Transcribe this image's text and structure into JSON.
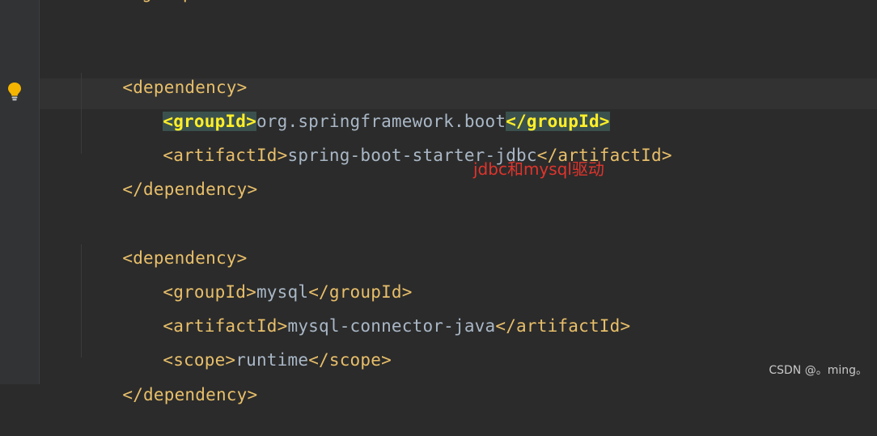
{
  "editor": {
    "top_fragment": "</groupId>",
    "lines": {
      "dep1_open": "<dependency>",
      "dep1_group_open": "<groupId>",
      "dep1_group_value": "org.springframework.boot",
      "dep1_group_close": "</groupId>",
      "dep1_artifact_open": "<artifactId>",
      "dep1_artifact_value": "spring-boot-starter-jdbc",
      "dep1_artifact_close": "</artifactId>",
      "dep1_close": "</dependency>",
      "dep2_open": "<dependency>",
      "dep2_group_open": "<groupId>",
      "dep2_group_value": "mysql",
      "dep2_group_close": "</groupId>",
      "dep2_artifact_open": "<artifactId>",
      "dep2_artifact_value": "mysql-connector-java",
      "dep2_artifact_close": "</artifactId>",
      "dep2_scope_open": "<scope>",
      "dep2_scope_value": "runtime",
      "dep2_scope_close": "</scope>",
      "dep2_close": "</dependency>"
    },
    "annotation": "jdbc和mysql驱动",
    "gutter_icon": "lightbulb-icon"
  },
  "watermark": "CSDN @。ming。",
  "colors": {
    "background": "#2b2b2b",
    "tag": "#e8bf6a",
    "text": "#a9b7c6",
    "match_highlight": "#3b514d",
    "annotation": "#e0342c"
  }
}
